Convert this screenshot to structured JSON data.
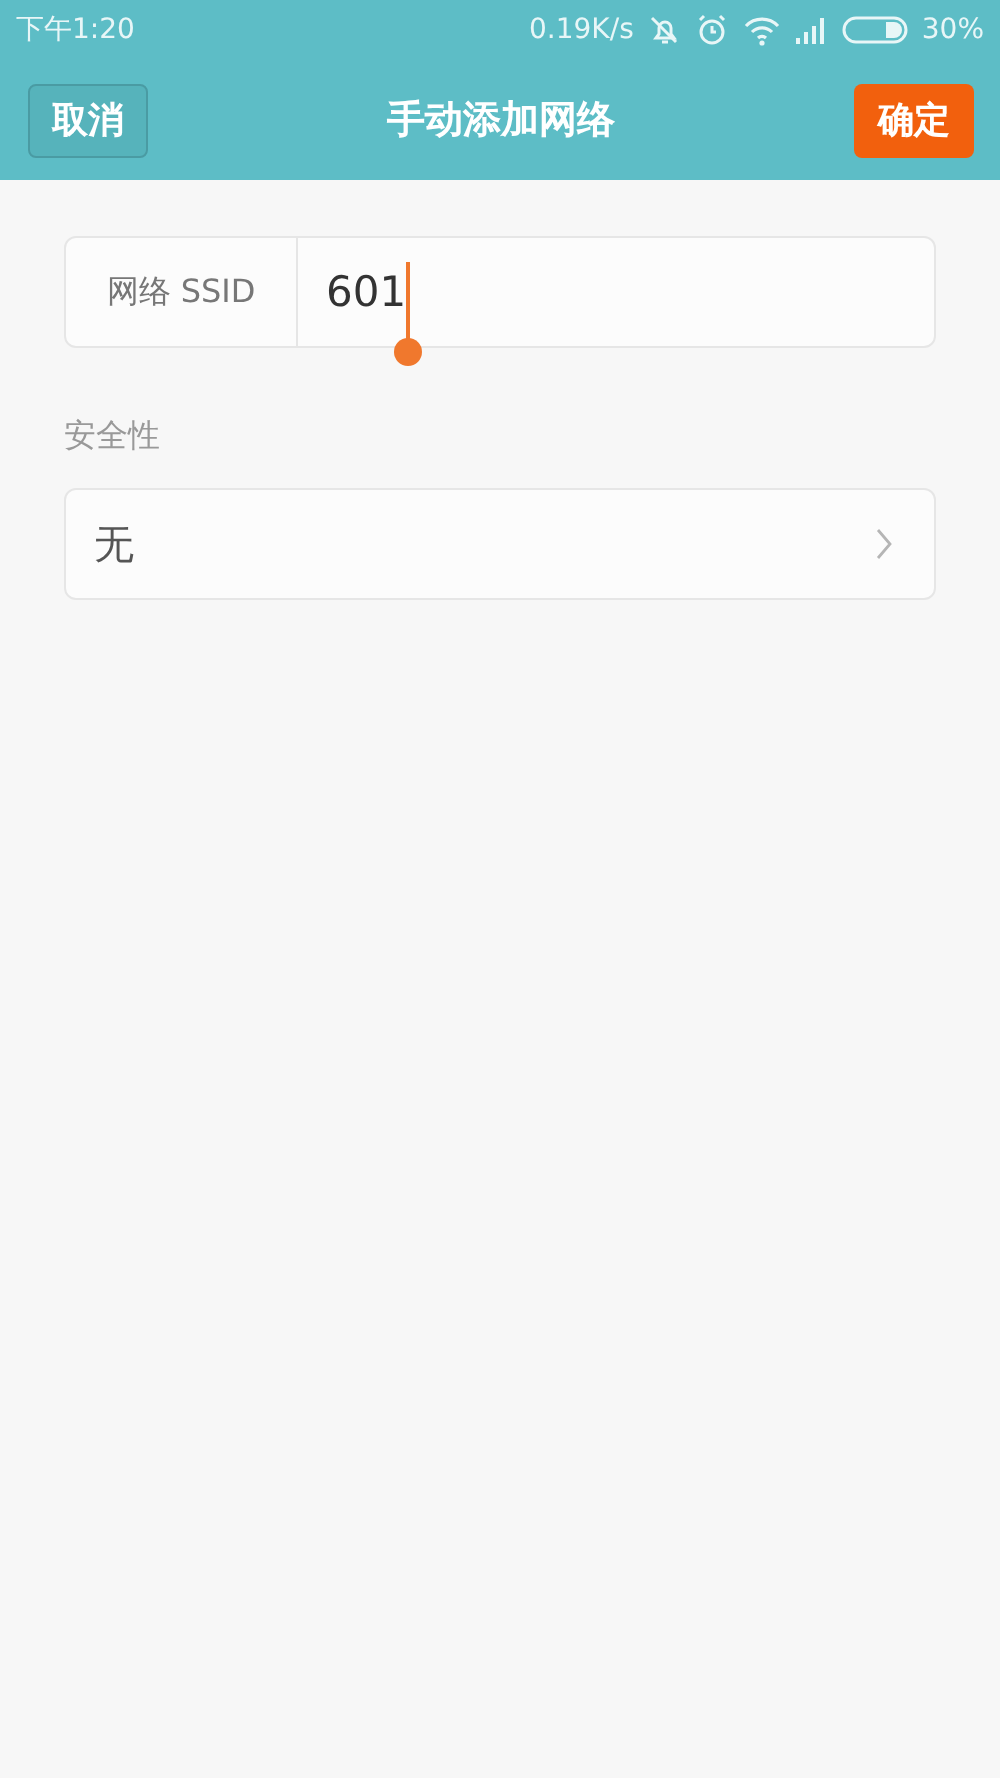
{
  "status_bar": {
    "time": "下午1:20",
    "speed": "0.19K/s",
    "battery": "30%"
  },
  "header": {
    "title": "手动添加网络",
    "cancel": "取消",
    "confirm": "确定"
  },
  "ssid": {
    "label": "网络 SSID",
    "value": "601",
    "focused": true
  },
  "security": {
    "label": "安全性",
    "value": "无"
  }
}
